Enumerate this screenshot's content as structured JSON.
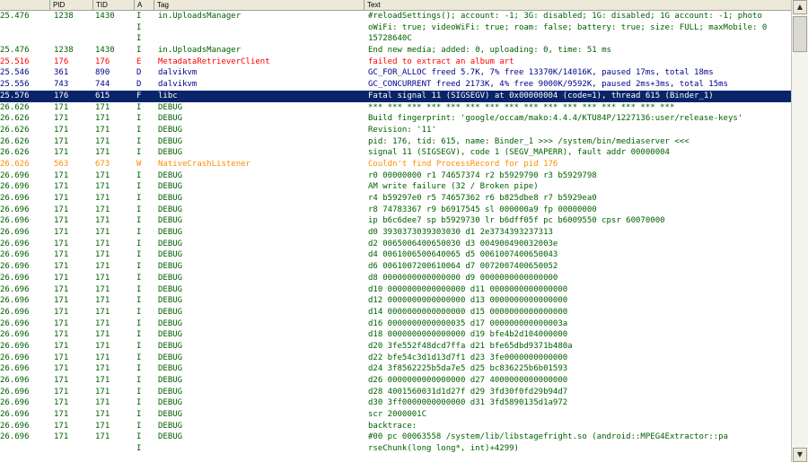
{
  "columns": [
    "",
    "PID",
    "TID",
    "A",
    "Tag",
    "Text"
  ],
  "rows": [
    {
      "time": "25.476",
      "pid": "1238",
      "tid": "1430",
      "lvl": "I",
      "tag": "in.UploadsManager",
      "text": "#reloadSettings(); account: -1; 3G: disabled; 1G: disabled; 1G account: -1; photo"
    },
    {
      "time": "",
      "pid": "",
      "tid": "",
      "lvl": "I",
      "tag": "",
      "text": "oWiFi: true; videoWiFi: true; roam: false; battery: true; size: FULL; maxMobile: 0"
    },
    {
      "time": "",
      "pid": "",
      "tid": "",
      "lvl": "I",
      "tag": "",
      "text": " 15728640C"
    },
    {
      "time": "25.476",
      "pid": "1238",
      "tid": "1430",
      "lvl": "I",
      "tag": "in.UploadsManager",
      "text": "End new media; added: 0, uploading: 0, time: 51 ms"
    },
    {
      "time": "25.516",
      "pid": "176",
      "tid": "176",
      "lvl": "E",
      "tag": "MetadataRetrieverClient",
      "text": "failed to extract an album art"
    },
    {
      "time": "25.546",
      "pid": "361",
      "tid": "890",
      "lvl": "D",
      "tag": "dalvikvm",
      "text": "GC_FOR_ALLOC freed 5.7K, 7% free 13370K/14016K, paused 17ms, total 18ms"
    },
    {
      "time": "25.556",
      "pid": "743",
      "tid": "744",
      "lvl": "D",
      "tag": "dalvikvm",
      "text": "GC_CONCURRENT freed 2173K, 4% free 9000K/9592K, paused 2ms+3ms, total 15ms"
    },
    {
      "time": "25.576",
      "pid": "176",
      "tid": "615",
      "lvl": "F",
      "tag": "libc",
      "text": "Fatal signal 11 (SIGSEGV) at 0x00000004 (code=1), thread 615 (Binder_1)",
      "sel": true
    },
    {
      "time": "26.626",
      "pid": "171",
      "tid": "171",
      "lvl": "I",
      "tag": "DEBUG",
      "text": "*** *** *** *** *** *** *** *** *** *** *** *** *** *** *** ***"
    },
    {
      "time": "26.626",
      "pid": "171",
      "tid": "171",
      "lvl": "I",
      "tag": "DEBUG",
      "text": "Build fingerprint: 'google/occam/mako:4.4.4/KTU84P/1227136:user/release-keys'"
    },
    {
      "time": "26.626",
      "pid": "171",
      "tid": "171",
      "lvl": "I",
      "tag": "DEBUG",
      "text": "Revision: '11'"
    },
    {
      "time": "26.626",
      "pid": "171",
      "tid": "171",
      "lvl": "I",
      "tag": "DEBUG",
      "text": "pid: 176, tid: 615, name: Binder_1  >>> /system/bin/mediaserver <<<"
    },
    {
      "time": "26.626",
      "pid": "171",
      "tid": "171",
      "lvl": "I",
      "tag": "DEBUG",
      "text": "signal 11 (SIGSEGV), code 1 (SEGV_MAPERR), fault addr 00000004"
    },
    {
      "time": "26.626",
      "pid": "563",
      "tid": "673",
      "lvl": "W",
      "tag": "NativeCrashListener",
      "text": "Couldn't find ProcessRecord for pid 176"
    },
    {
      "time": "26.696",
      "pid": "171",
      "tid": "171",
      "lvl": "I",
      "tag": "DEBUG",
      "text": "    r0 00000000  r1 74657374  r2 b5929790  r3 b5929798"
    },
    {
      "time": "26.696",
      "pid": "171",
      "tid": "171",
      "lvl": "I",
      "tag": "DEBUG",
      "text": "AM write failure (32 / Broken pipe)"
    },
    {
      "time": "26.696",
      "pid": "171",
      "tid": "171",
      "lvl": "I",
      "tag": "DEBUG",
      "text": "    r4 b59297e0  r5 74657362  r6 b825dbe8  r7 b5929ea0"
    },
    {
      "time": "26.696",
      "pid": "171",
      "tid": "171",
      "lvl": "I",
      "tag": "DEBUG",
      "text": "    r8 74783367  r9 b6917545  sl 000000a9  fp 00000000"
    },
    {
      "time": "26.696",
      "pid": "171",
      "tid": "171",
      "lvl": "I",
      "tag": "DEBUG",
      "text": "    ip b6c6dee7  sp b5929730  lr b6dff05f  pc b6009550  cpsr 60070000"
    },
    {
      "time": "26.696",
      "pid": "171",
      "tid": "171",
      "lvl": "I",
      "tag": "DEBUG",
      "text": "    d0  3930373039303030  d1  2e3734393237313"
    },
    {
      "time": "26.696",
      "pid": "171",
      "tid": "171",
      "lvl": "I",
      "tag": "DEBUG",
      "text": "    d2  0065006400650030  d3  004900490032003e"
    },
    {
      "time": "26.696",
      "pid": "171",
      "tid": "171",
      "lvl": "I",
      "tag": "DEBUG",
      "text": "    d4  0061006500640065  d5  0061007400650043"
    },
    {
      "time": "26.696",
      "pid": "171",
      "tid": "171",
      "lvl": "I",
      "tag": "DEBUG",
      "text": "    d6  0061007200610064  d7  0072007400650052"
    },
    {
      "time": "26.696",
      "pid": "171",
      "tid": "171",
      "lvl": "I",
      "tag": "DEBUG",
      "text": "    d8  0000000000000000  d9  0000000000000000"
    },
    {
      "time": "26.696",
      "pid": "171",
      "tid": "171",
      "lvl": "I",
      "tag": "DEBUG",
      "text": "    d10 0000000000000000  d11 0000000000000000"
    },
    {
      "time": "26.696",
      "pid": "171",
      "tid": "171",
      "lvl": "I",
      "tag": "DEBUG",
      "text": "    d12 0000000000000000  d13 0000000000000000"
    },
    {
      "time": "26.696",
      "pid": "171",
      "tid": "171",
      "lvl": "I",
      "tag": "DEBUG",
      "text": "    d14 0000000000000000  d15 0000000000000000"
    },
    {
      "time": "26.696",
      "pid": "171",
      "tid": "171",
      "lvl": "I",
      "tag": "DEBUG",
      "text": "    d16 0000000000000035  d17 000000000000003a"
    },
    {
      "time": "26.696",
      "pid": "171",
      "tid": "171",
      "lvl": "I",
      "tag": "DEBUG",
      "text": "    d18 0000000000000000  d19 bfe4b2d104000000"
    },
    {
      "time": "26.696",
      "pid": "171",
      "tid": "171",
      "lvl": "I",
      "tag": "DEBUG",
      "text": "    d20 3fe552f48dcd7ffa  d21 bfe65dbd9371b480a"
    },
    {
      "time": "26.696",
      "pid": "171",
      "tid": "171",
      "lvl": "I",
      "tag": "DEBUG",
      "text": "    d22 bfe54c3d1d13d7f1  d23 3fe0000000000000"
    },
    {
      "time": "26.696",
      "pid": "171",
      "tid": "171",
      "lvl": "I",
      "tag": "DEBUG",
      "text": "    d24 3f8562225b5da7e5  d25 bc836225b6b01593"
    },
    {
      "time": "26.696",
      "pid": "171",
      "tid": "171",
      "lvl": "I",
      "tag": "DEBUG",
      "text": "    d26 0000000000000000  d27 4000000000000000"
    },
    {
      "time": "26.696",
      "pid": "171",
      "tid": "171",
      "lvl": "I",
      "tag": "DEBUG",
      "text": "    d28 4001560031d1d27f  d29 3fd30f0fd29b94d7"
    },
    {
      "time": "26.696",
      "pid": "171",
      "tid": "171",
      "lvl": "I",
      "tag": "DEBUG",
      "text": "    d30 3ff0000000000000  d31 3fd5890135d1a972"
    },
    {
      "time": "26.696",
      "pid": "171",
      "tid": "171",
      "lvl": "I",
      "tag": "DEBUG",
      "text": "    scr 2000001C"
    },
    {
      "time": "26.696",
      "pid": "171",
      "tid": "171",
      "lvl": "I",
      "tag": "DEBUG",
      "text": "backtrace:"
    },
    {
      "time": "26.696",
      "pid": "171",
      "tid": "171",
      "lvl": "I",
      "tag": "DEBUG",
      "text": "    #00  pc 00063558  /system/lib/libstagefright.so (android::MPEG4Extractor::pa"
    },
    {
      "time": "",
      "pid": "",
      "tid": "",
      "lvl": "I",
      "tag": "",
      "text": "rseChunk(long long*, int)+4299)"
    }
  ]
}
